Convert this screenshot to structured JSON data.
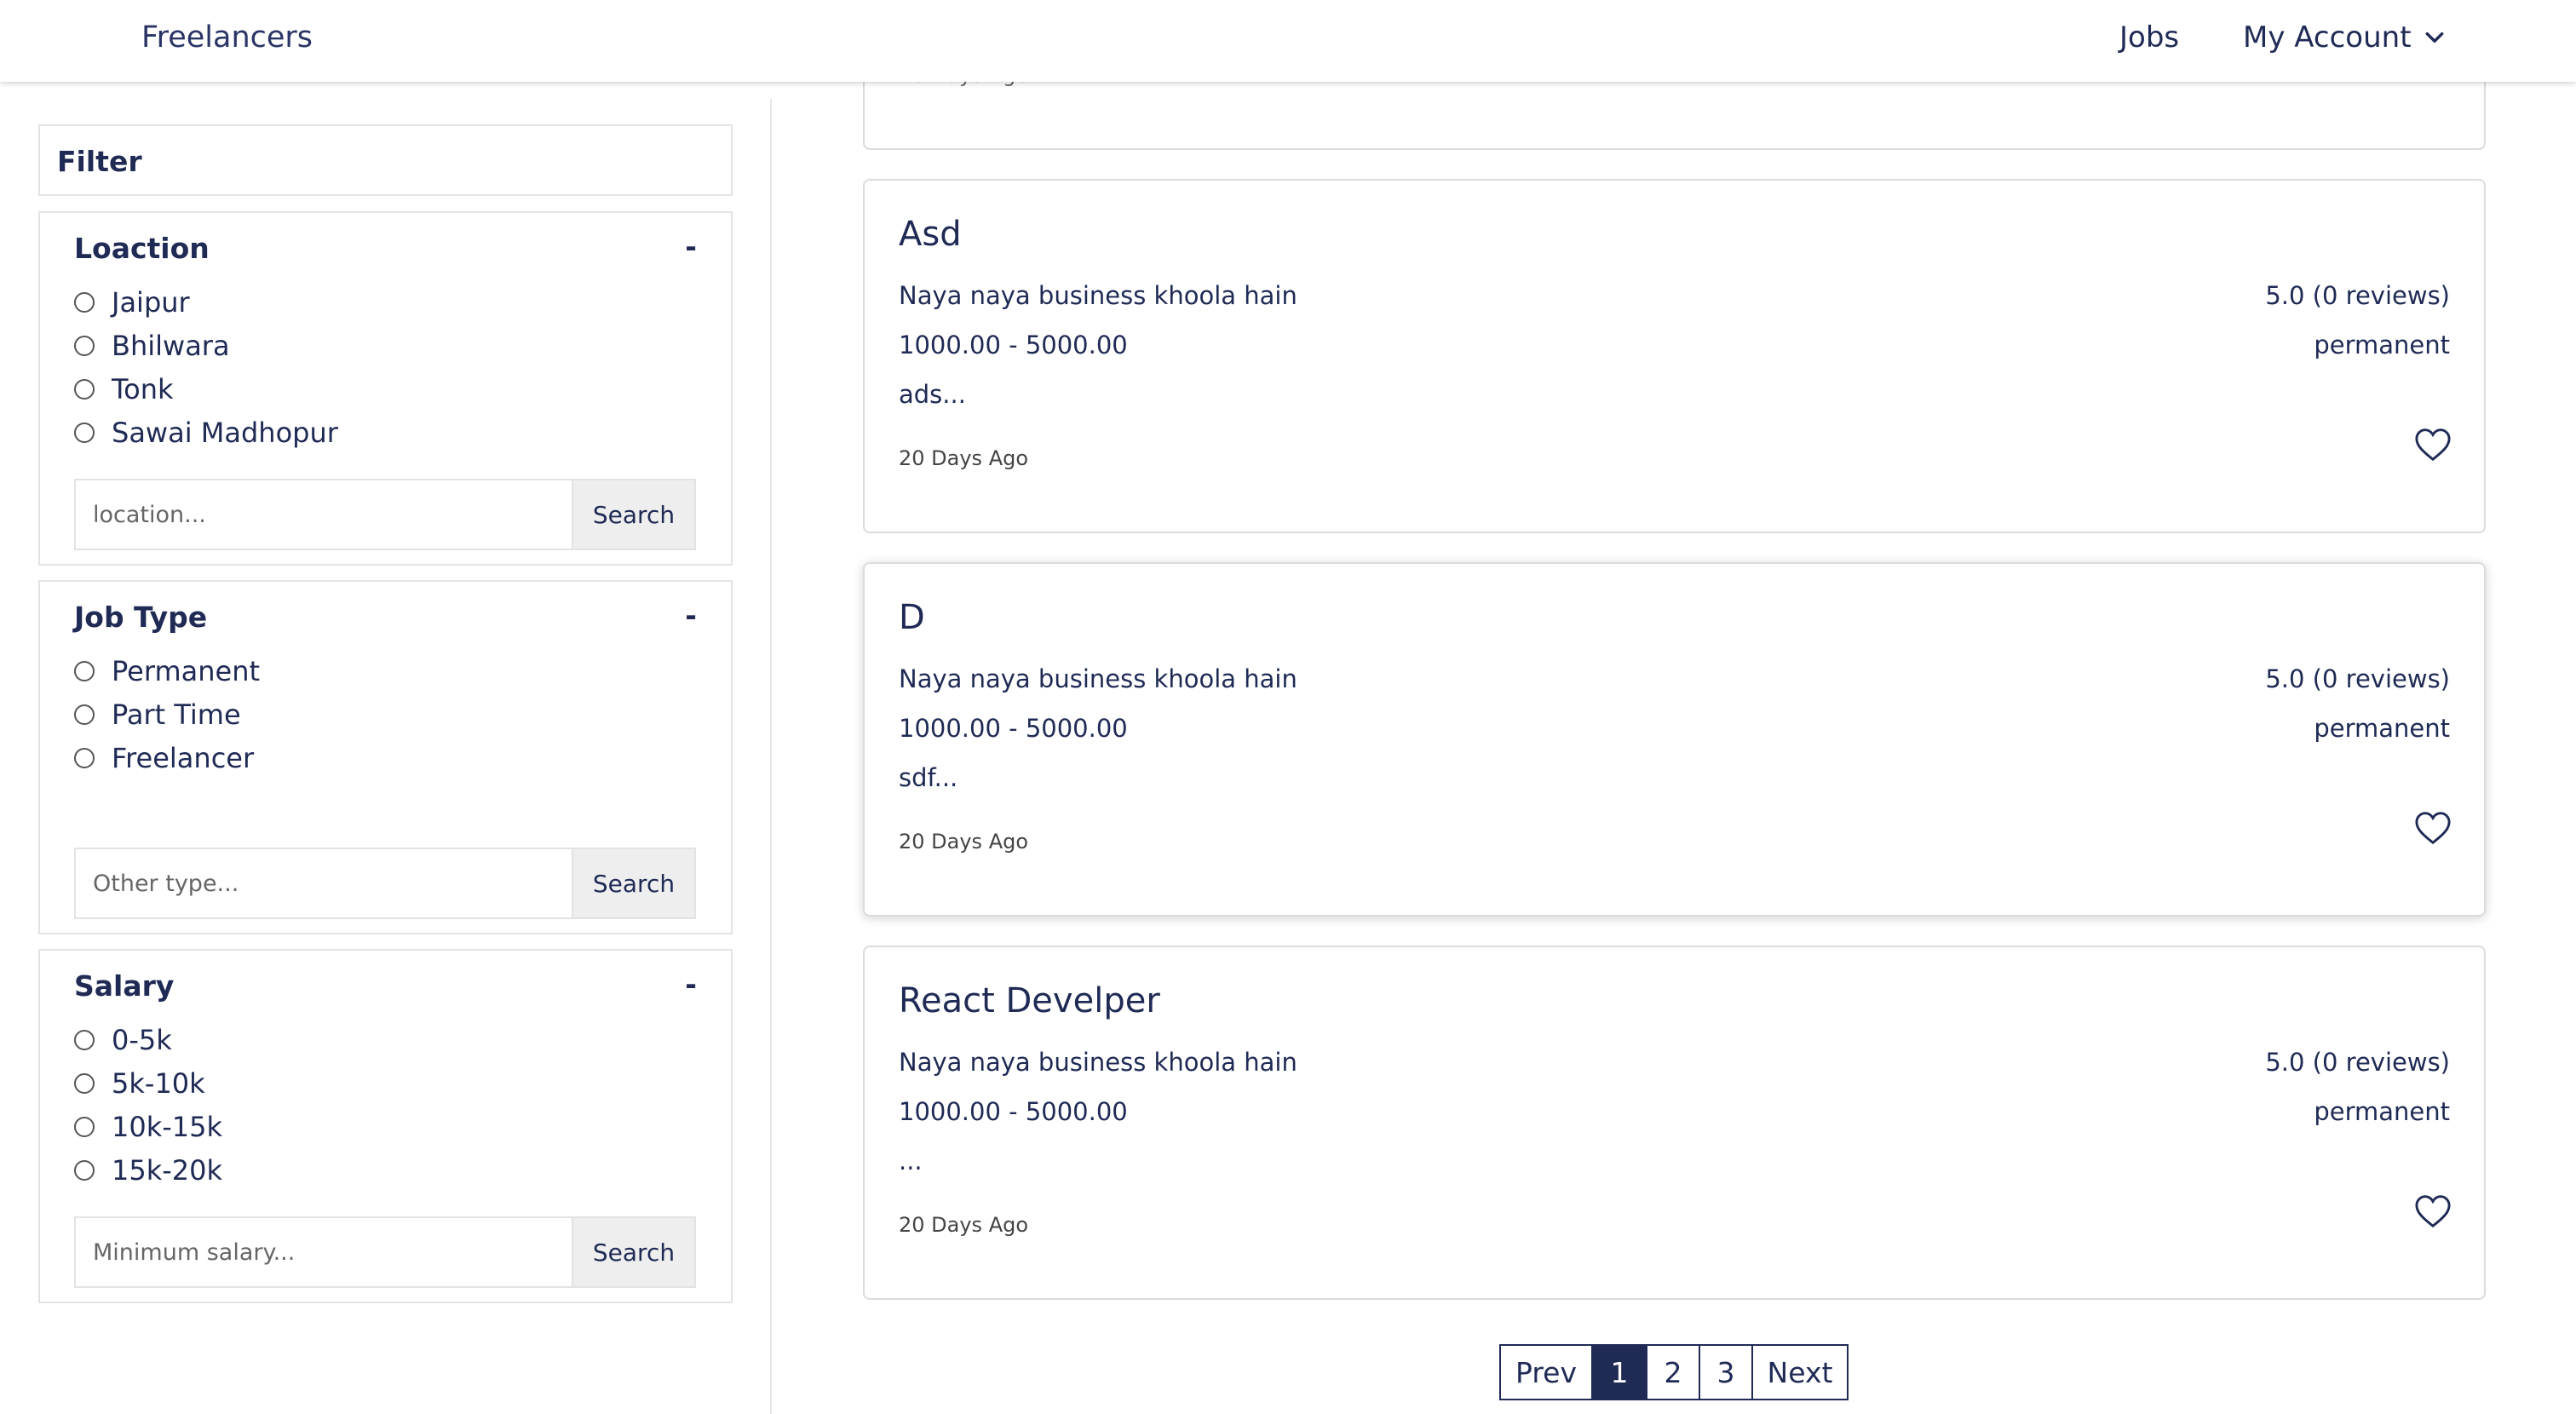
{
  "header": {
    "brand": "Freelancers",
    "nav_jobs": "Jobs",
    "nav_account": "My Account"
  },
  "sidebar": {
    "filter_title": "Filter",
    "location": {
      "title": "Loaction",
      "toggle": "-",
      "options": [
        "Jaipur",
        "Bhilwara",
        "Tonk",
        "Sawai Madhopur"
      ],
      "placeholder": "location...",
      "button": "Search"
    },
    "job_type": {
      "title": "Job Type",
      "toggle": "-",
      "options": [
        "Permanent",
        "Part Time",
        "Freelancer"
      ],
      "placeholder": "Other type...",
      "button": "Search"
    },
    "salary": {
      "title": "Salary",
      "toggle": "-",
      "options": [
        "0-5k",
        "5k-10k",
        "10k-15k",
        "15k-20k"
      ],
      "placeholder": "Minimum salary...",
      "button": "Search"
    }
  },
  "jobs": {
    "partial_date": "20 Days Ago",
    "cards": [
      {
        "title": "Asd",
        "company": "Naya naya business khoola hain",
        "rating": "5.0 (0 reviews)",
        "salary": "1000.00 - 5000.00",
        "type": "permanent",
        "excerpt": "ads...",
        "date": "20 Days Ago"
      },
      {
        "title": "D",
        "company": "Naya naya business khoola hain",
        "rating": "5.0 (0 reviews)",
        "salary": "1000.00 - 5000.00",
        "type": "permanent",
        "excerpt": "sdf...",
        "date": "20 Days Ago"
      },
      {
        "title": "React Develper",
        "company": "Naya naya business khoola hain",
        "rating": "5.0 (0 reviews)",
        "salary": "1000.00 - 5000.00",
        "type": "permanent",
        "excerpt": "...",
        "date": "20 Days Ago"
      }
    ]
  },
  "pagination": {
    "prev": "Prev",
    "pages": [
      "1",
      "2",
      "3"
    ],
    "current": "1",
    "next": "Next"
  },
  "colors": {
    "primary": "#1f2a55",
    "border": "#dcdcdc",
    "button_bg": "#eeeeee"
  }
}
